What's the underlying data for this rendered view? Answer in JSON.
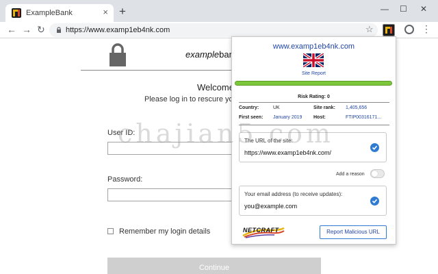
{
  "browser": {
    "tab": {
      "title": "ExampleBank",
      "close": "×"
    },
    "new_tab": "+",
    "window_controls": {
      "minimize": "—",
      "maximize": "☐",
      "close": "✕"
    },
    "nav": {
      "back": "←",
      "forward": "→",
      "reload": "↻"
    },
    "address": {
      "url": "https://www.examp1eb4nk.com"
    },
    "star": "☆",
    "menu": "⋮"
  },
  "page": {
    "brand_italic": "example",
    "brand_rest": "ban",
    "welcome": "Welcome",
    "please": "Please log in to rescure yo",
    "userid_label": "User ID:",
    "password_label": "Password:",
    "remember": "Remember my login details",
    "continue": "Continue"
  },
  "popup": {
    "site_url": "www.examp1eb4nk.com",
    "site_report": "Site Report",
    "risk_rating": "Risk Rating: 0",
    "risk_level": 1.0,
    "country_label": "Country:",
    "country": "UK",
    "site_rank_label": "Site rank:",
    "site_rank": "1,405,656",
    "first_seen_label": "First seen:",
    "first_seen": "January 2019",
    "host_label": "Host:",
    "host": "FTIP00316171...",
    "url_card_label": "The URL of the site:",
    "url_card_value": "https://www.examp1eb4nk.com/",
    "add_reason": "Add a reason",
    "email_card_label": "Your email address (to receive updates):",
    "email_card_value": "you@example.com",
    "netcraft_logo": "NETCRAFT",
    "report_button": "Report Malicious URL"
  },
  "watermark": "chajian5.com",
  "colors": {
    "accent_blue": "#2246a6",
    "risk_green": "#7dc83a",
    "check_blue": "#2f7bd1"
  },
  "icons": [
    "netcraft-favicon-icon",
    "lock-icon",
    "star-icon",
    "account-icon",
    "menu-icon",
    "uk-flag-icon",
    "check-icon"
  ]
}
